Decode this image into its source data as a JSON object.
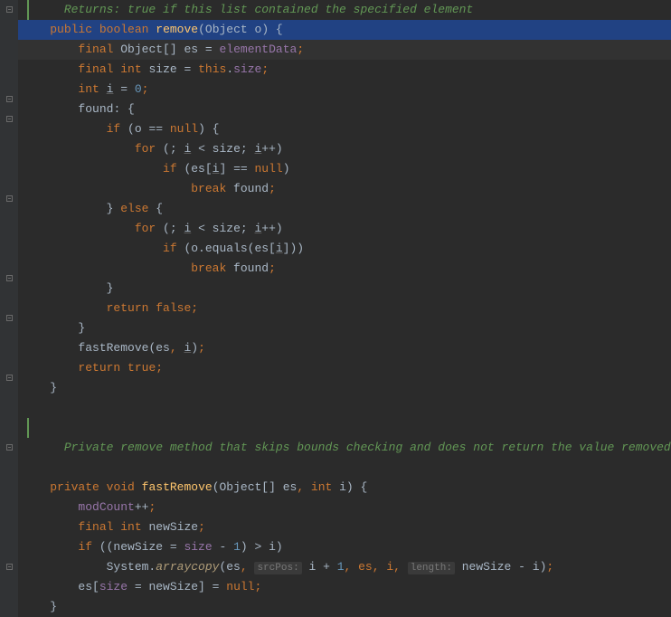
{
  "doc1": "Returns: true if this list contained the specified element",
  "l1": {
    "kw1": "public",
    "kw2": "boolean",
    "method": "remove",
    "param": "Object o",
    "brace": ") {"
  },
  "l2": {
    "kw": "final",
    "type": "Object[]",
    "var": "es",
    "eq": " = ",
    "field": "elementData",
    "semi": ";"
  },
  "l3": {
    "kw1": "final",
    "kw2": "int",
    "var": "size",
    "eq": " = ",
    "this": "this",
    "dot": ".",
    "field": "size",
    "semi": ";"
  },
  "l4": {
    "kw": "int",
    "var": "i",
    "eq": " = ",
    "val": "0",
    "semi": ";"
  },
  "l5": {
    "label": "found",
    "colon": ": {"
  },
  "l6": {
    "kw": "if",
    "open": " (o == ",
    "null": "null",
    "close": ") {"
  },
  "l7": {
    "kw": "for",
    "open": " (; ",
    "i": "i",
    "cmp": " < size; ",
    "i2": "i",
    "inc": "++)"
  },
  "l8": {
    "kw": "if",
    "open": " (es[",
    "i": "i",
    "close": "] == ",
    "null": "null",
    "paren": ")"
  },
  "l9": {
    "kw": "break",
    "label": " found",
    "semi": ";"
  },
  "l10": {
    "close": "}",
    "kw": " else ",
    "open": "{"
  },
  "l11": {
    "kw": "for",
    "open": " (; ",
    "i": "i",
    "cmp": " < size; ",
    "i2": "i",
    "inc": "++)"
  },
  "l12": {
    "kw": "if",
    "open": " (o.equals(es[",
    "i": "i",
    "close": "]))"
  },
  "l13": {
    "kw": "break",
    "label": " found",
    "semi": ";"
  },
  "l14": {
    "close": "}"
  },
  "l15": {
    "kw": "return",
    "val": " false",
    "semi": ";"
  },
  "l16": {
    "close": "}"
  },
  "l17": {
    "method": "fastRemove",
    "open": "(es",
    ", ": ", ",
    "i": "i",
    "close": ")",
    "semi": ";"
  },
  "l18": {
    "kw": "return",
    "val": " true",
    "semi": ";"
  },
  "l19": {
    "close": "}"
  },
  "doc2": "Private remove method that skips bounds checking and does not return the value removed.",
  "l20": {
    "kw1": "private",
    "kw2": "void",
    "method": "fastRemove",
    "open": "(Object[] es",
    ", ": ", ",
    "kw3": "int",
    "param": " i)",
    "brace": " {"
  },
  "l21": {
    "field": "modCount",
    "inc": "++",
    "semi": ";"
  },
  "l22": {
    "kw1": "final",
    "kw2": "int",
    "var": "newSize",
    "semi": ";"
  },
  "l23": {
    "kw": "if",
    "open": " ((newSize = ",
    "field": "size",
    "minus": " - ",
    "one": "1",
    "close": ") > i)"
  },
  "l24": {
    "cls": "System.",
    "method": "arraycopy",
    "open": "(es",
    ", ": ", ",
    "hint1": "srcPos:",
    "arg1": " i + ",
    "one": "1",
    ", 2": ", es, i, ",
    "hint2": "length:",
    "arg2": " newSize - i)",
    "semi": ";"
  },
  "l25": {
    "open": "es[",
    "field": "size",
    "eq": " = newSize] = ",
    "null": "null",
    "semi": ";"
  },
  "l26": {
    "close": "}"
  }
}
